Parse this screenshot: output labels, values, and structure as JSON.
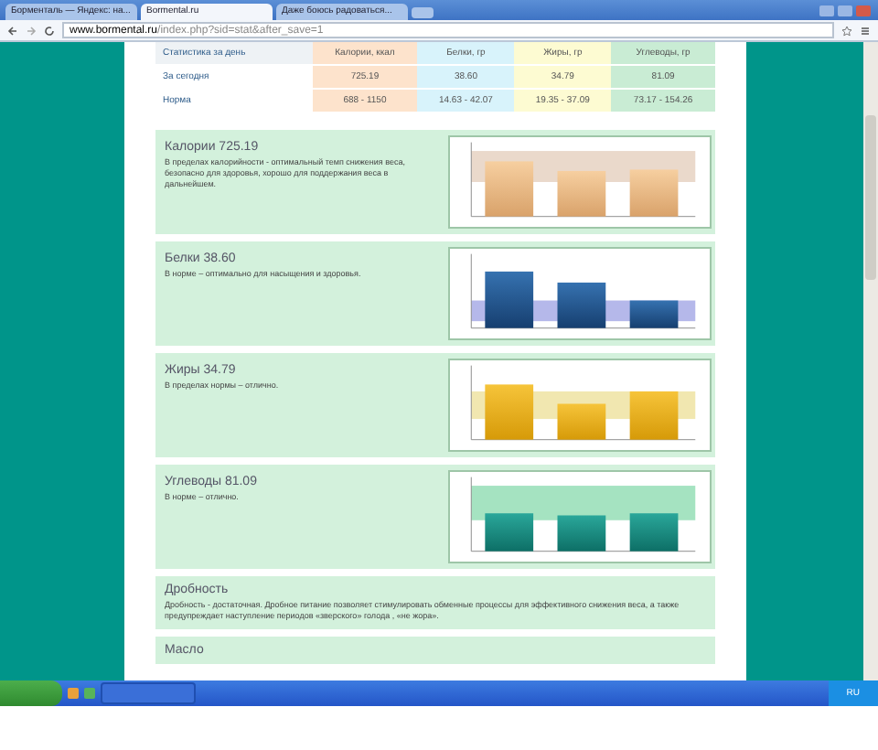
{
  "browser": {
    "tabs": [
      {
        "label": "Борменталь — Яндекс: на...",
        "selected": false
      },
      {
        "label": "Bormental.ru",
        "selected": true
      },
      {
        "label": "Даже боюсь радоваться...",
        "selected": false
      }
    ],
    "address": {
      "host": "www.bormental.ru",
      "path": "/index.php?sid=stat&after_save=1"
    }
  },
  "stats_table": {
    "columns": [
      "Статистика за день",
      "Калории, ккал",
      "Белки, гр",
      "Жиры, гр",
      "Углеводы, гр"
    ],
    "rows": [
      [
        "За сегодня",
        "725.19",
        "38.60",
        "34.79",
        "81.09"
      ],
      [
        "Норма",
        "688 - 1150",
        "14.63 - 42.07",
        "19.35 - 37.09",
        "73.17 - 154.26"
      ]
    ]
  },
  "cards": [
    {
      "kind": "calories",
      "title": "Калории 725.19",
      "text": "В пределах калорийности - оптимальный темп снижения веса, безопасно для здоровья, хорошо для поддержания веса в дальнейшем."
    },
    {
      "kind": "protein",
      "title": "Белки 38.60",
      "text": "В норме – оптимально для насыщения и здоровья."
    },
    {
      "kind": "fat",
      "title": "Жиры 34.79",
      "text": "В пределах нормы – отлично."
    },
    {
      "kind": "carbs",
      "title": "Углеводы 81.09",
      "text": "В норме – отлично."
    },
    {
      "kind": "note",
      "title": "Дробность",
      "text": "Дробность - достаточная. Дробное питание позволяет стимулировать обменные процессы для эффективного снижения веса, а также предупреждает наступление периодов «зверского» голода , «не жора»."
    },
    {
      "kind": "note",
      "title": "Масло"
    }
  ],
  "taskbar": {
    "language": "RU"
  }
}
